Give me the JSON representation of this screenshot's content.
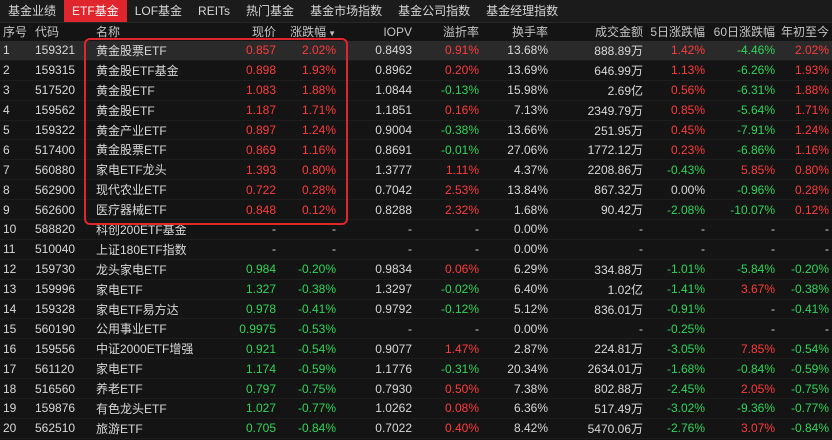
{
  "tabs": [
    "基金业绩",
    "ETF基金",
    "LOF基金",
    "REITs",
    "热门基金",
    "基金市场指数",
    "基金公司指数",
    "基金经理指数"
  ],
  "active_tab": 1,
  "columns": {
    "idx": "序号",
    "code": "代码",
    "name": "名称",
    "price": "现价",
    "chg": "涨跌幅",
    "iopv": "IOPV",
    "prem": "溢折率",
    "turn": "换手率",
    "amt": "成交金额",
    "d5": "5日涨跌幅",
    "d60": "60日涨跌幅",
    "ytd": "年初至今"
  },
  "sort_indicator": "▼",
  "rows": [
    {
      "idx": "1",
      "code": "159321",
      "name": "黄金股票ETF",
      "price": "0.857",
      "chg": "2.02%",
      "iopv": "0.8493",
      "prem": "0.91%",
      "turn": "13.68%",
      "amt": "888.89万",
      "d5": "1.42%",
      "d60": "-4.46%",
      "ytd": "2.02%"
    },
    {
      "idx": "2",
      "code": "159315",
      "name": "黄金股ETF基金",
      "price": "0.898",
      "chg": "1.93%",
      "iopv": "0.8962",
      "prem": "0.20%",
      "turn": "13.69%",
      "amt": "646.99万",
      "d5": "1.13%",
      "d60": "-6.26%",
      "ytd": "1.93%"
    },
    {
      "idx": "3",
      "code": "517520",
      "name": "黄金股ETF",
      "price": "1.083",
      "chg": "1.88%",
      "iopv": "1.0844",
      "prem": "-0.13%",
      "turn": "15.98%",
      "amt": "2.69亿",
      "d5": "0.56%",
      "d60": "-6.31%",
      "ytd": "1.88%"
    },
    {
      "idx": "4",
      "code": "159562",
      "name": "黄金股ETF",
      "price": "1.187",
      "chg": "1.71%",
      "iopv": "1.1851",
      "prem": "0.16%",
      "turn": "7.13%",
      "amt": "2349.79万",
      "d5": "0.85%",
      "d60": "-5.64%",
      "ytd": "1.71%"
    },
    {
      "idx": "5",
      "code": "159322",
      "name": "黄金产业ETF",
      "price": "0.897",
      "chg": "1.24%",
      "iopv": "0.9004",
      "prem": "-0.38%",
      "turn": "13.66%",
      "amt": "251.95万",
      "d5": "0.45%",
      "d60": "-7.91%",
      "ytd": "1.24%"
    },
    {
      "idx": "6",
      "code": "517400",
      "name": "黄金股票ETF",
      "price": "0.869",
      "chg": "1.16%",
      "iopv": "0.8691",
      "prem": "-0.01%",
      "turn": "27.06%",
      "amt": "1772.12万",
      "d5": "0.23%",
      "d60": "-6.86%",
      "ytd": "1.16%"
    },
    {
      "idx": "7",
      "code": "560880",
      "name": "家电ETF龙头",
      "price": "1.393",
      "chg": "0.80%",
      "iopv": "1.3777",
      "prem": "1.11%",
      "turn": "4.37%",
      "amt": "2208.86万",
      "d5": "-0.43%",
      "d60": "5.85%",
      "ytd": "0.80%"
    },
    {
      "idx": "8",
      "code": "562900",
      "name": "现代农业ETF",
      "price": "0.722",
      "chg": "0.28%",
      "iopv": "0.7042",
      "prem": "2.53%",
      "turn": "13.84%",
      "amt": "867.32万",
      "d5": "0.00%",
      "d60": "-0.96%",
      "ytd": "0.28%"
    },
    {
      "idx": "9",
      "code": "562600",
      "name": "医疗器械ETF",
      "price": "0.848",
      "chg": "0.12%",
      "iopv": "0.8288",
      "prem": "2.32%",
      "turn": "1.68%",
      "amt": "90.42万",
      "d5": "-2.08%",
      "d60": "-10.07%",
      "ytd": "0.12%"
    },
    {
      "idx": "10",
      "code": "588820",
      "name": "科创200ETF基金",
      "price": "-",
      "chg": "-",
      "iopv": "-",
      "prem": "-",
      "turn": "0.00%",
      "amt": "-",
      "d5": "-",
      "d60": "-",
      "ytd": "-"
    },
    {
      "idx": "11",
      "code": "510040",
      "name": "上证180ETF指数",
      "price": "-",
      "chg": "-",
      "iopv": "-",
      "prem": "-",
      "turn": "0.00%",
      "amt": "-",
      "d5": "-",
      "d60": "-",
      "ytd": "-"
    },
    {
      "idx": "12",
      "code": "159730",
      "name": "龙头家电ETF",
      "price": "0.984",
      "chg": "-0.20%",
      "iopv": "0.9834",
      "prem": "0.06%",
      "turn": "6.29%",
      "amt": "334.88万",
      "d5": "-1.01%",
      "d60": "-5.84%",
      "ytd": "-0.20%"
    },
    {
      "idx": "13",
      "code": "159996",
      "name": "家电ETF",
      "price": "1.327",
      "chg": "-0.38%",
      "iopv": "1.3297",
      "prem": "-0.02%",
      "turn": "6.40%",
      "amt": "1.02亿",
      "d5": "-1.41%",
      "d60": "3.67%",
      "ytd": "-0.38%"
    },
    {
      "idx": "14",
      "code": "159328",
      "name": "家电ETF易方达",
      "price": "0.978",
      "chg": "-0.41%",
      "iopv": "0.9792",
      "prem": "-0.12%",
      "turn": "5.12%",
      "amt": "836.01万",
      "d5": "-0.91%",
      "d60": "-",
      "ytd": "-0.41%"
    },
    {
      "idx": "15",
      "code": "560190",
      "name": "公用事业ETF",
      "price": "0.9975",
      "chg": "-0.53%",
      "iopv": "-",
      "prem": "-",
      "turn": "0.00%",
      "amt": "-",
      "d5": "-0.25%",
      "d60": "-",
      "ytd": "-"
    },
    {
      "idx": "16",
      "code": "159556",
      "name": "中证2000ETF增强",
      "price": "0.921",
      "chg": "-0.54%",
      "iopv": "0.9077",
      "prem": "1.47%",
      "turn": "2.87%",
      "amt": "224.81万",
      "d5": "-3.05%",
      "d60": "7.85%",
      "ytd": "-0.54%"
    },
    {
      "idx": "17",
      "code": "561120",
      "name": "家电ETF",
      "price": "1.174",
      "chg": "-0.59%",
      "iopv": "1.1776",
      "prem": "-0.31%",
      "turn": "20.34%",
      "amt": "2634.01万",
      "d5": "-1.68%",
      "d60": "-0.84%",
      "ytd": "-0.59%"
    },
    {
      "idx": "18",
      "code": "516560",
      "name": "养老ETF",
      "price": "0.797",
      "chg": "-0.75%",
      "iopv": "0.7930",
      "prem": "0.50%",
      "turn": "7.38%",
      "amt": "802.88万",
      "d5": "-2.45%",
      "d60": "2.05%",
      "ytd": "-0.75%"
    },
    {
      "idx": "19",
      "code": "159876",
      "name": "有色龙头ETF",
      "price": "1.027",
      "chg": "-0.77%",
      "iopv": "1.0262",
      "prem": "0.08%",
      "turn": "6.36%",
      "amt": "517.49万",
      "d5": "-3.02%",
      "d60": "-9.36%",
      "ytd": "-0.77%"
    },
    {
      "idx": "20",
      "code": "562510",
      "name": "旅游ETF",
      "price": "0.705",
      "chg": "-0.84%",
      "iopv": "0.7022",
      "prem": "0.40%",
      "turn": "8.42%",
      "amt": "5470.06万",
      "d5": "-2.76%",
      "d60": "3.07%",
      "ytd": "-0.84%"
    }
  ],
  "colors": {
    "up": "#ff3b3b",
    "down": "#2fd55a",
    "accent": "#e0262c"
  }
}
